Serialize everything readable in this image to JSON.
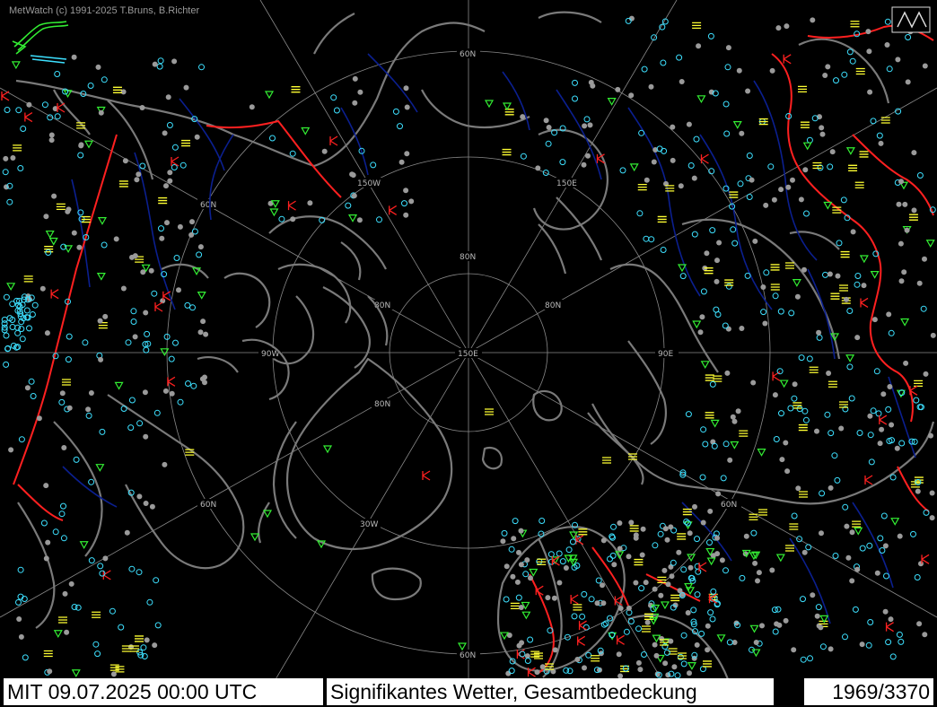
{
  "app": {
    "credit": "MetWatch  (c) 1991-2025 T.Bruns, B.Richter"
  },
  "status": {
    "datetime": "MIT 09.07.2025 00:00 UTC",
    "title": "Signifikantes Wetter, Gesamtbedeckung",
    "count": "1969/3370"
  },
  "graticule": {
    "latitude_labels": [
      "80N",
      "80N",
      "80N",
      "80N",
      "60N",
      "60N",
      "60N",
      "60N",
      "60N"
    ],
    "longitude_labels": [
      "150E",
      "150W",
      "150E",
      "90W",
      "90E",
      "30W"
    ]
  },
  "colors": {
    "background": "#000000",
    "coastline": "#7a7a7a",
    "graticule": "#8a8a8a",
    "rivers": "#0b1f8f",
    "borders": "#ff2020",
    "cloud_cover_clear": "#3de0ff",
    "cloud_cover_overcast": "#9a9a9a",
    "rain_symbols": "#33ee33",
    "fog_symbols": "#ffff33",
    "thunder_symbols": "#ff2020"
  },
  "legend_icon": "weather-front-logo-icon"
}
